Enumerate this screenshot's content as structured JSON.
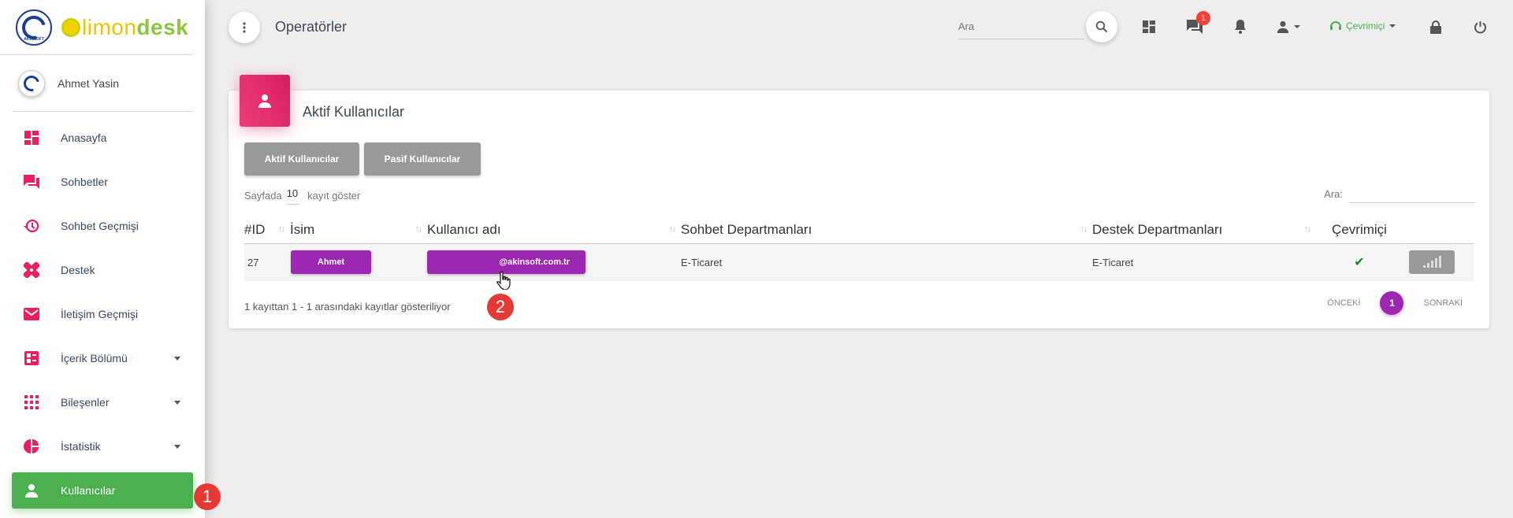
{
  "sidebar": {
    "brand_part1": "limon",
    "brand_part2": "desk",
    "logo_tag": "AKINSOFT",
    "user_name": "Ahmet Yasin",
    "items": [
      {
        "label": "Anasayfa",
        "icon": "dashboard-icon"
      },
      {
        "label": "Sohbetler",
        "icon": "chat-icon"
      },
      {
        "label": "Sohbet Geçmişi",
        "icon": "history-icon"
      },
      {
        "label": "Destek",
        "icon": "support-icon"
      },
      {
        "label": "İletişim Geçmişi",
        "icon": "mail-icon"
      },
      {
        "label": "İçerik Bölümü",
        "icon": "content-icon"
      },
      {
        "label": "Bileşenler",
        "icon": "apps-icon"
      },
      {
        "label": "İstatistik",
        "icon": "pie-chart-icon"
      },
      {
        "label": "Kullanıcılar",
        "icon": "person-icon"
      }
    ]
  },
  "markers": {
    "first": "1",
    "second": "2"
  },
  "header": {
    "title": "Operatörler",
    "search_placeholder": "Ara",
    "chat_badge": "1",
    "status_label": "Çevrimiçi"
  },
  "card": {
    "title": "Aktif Kullanıcılar",
    "tab_active": "Aktif Kullanıcılar",
    "tab_passive": "Pasif Kullanıcılar",
    "length_prefix": "Sayfada",
    "length_value": "10",
    "length_suffix": "kayıt göster",
    "filter_label": "Ara:",
    "columns": [
      "#ID",
      "İsim",
      "Kullanıcı adı",
      "Sohbet Departmanları",
      "Destek Departmanları",
      "Çevrimiçi"
    ],
    "rows": [
      {
        "id": "27",
        "name": "Ahmet",
        "username": "@akinsoft.com.tr",
        "chat_dept": "E-Ticaret",
        "support_dept": "E-Ticaret",
        "online": "✔"
      }
    ],
    "info": "1 kayıttan 1 - 1 arasındaki kayıtlar gösteriliyor",
    "prev": "ÖNCEKİ",
    "page": "1",
    "next": "SONRAKİ"
  },
  "colors": {
    "accent": "#4caf50",
    "pink": "#e91e63",
    "purple": "#9c27b0"
  }
}
